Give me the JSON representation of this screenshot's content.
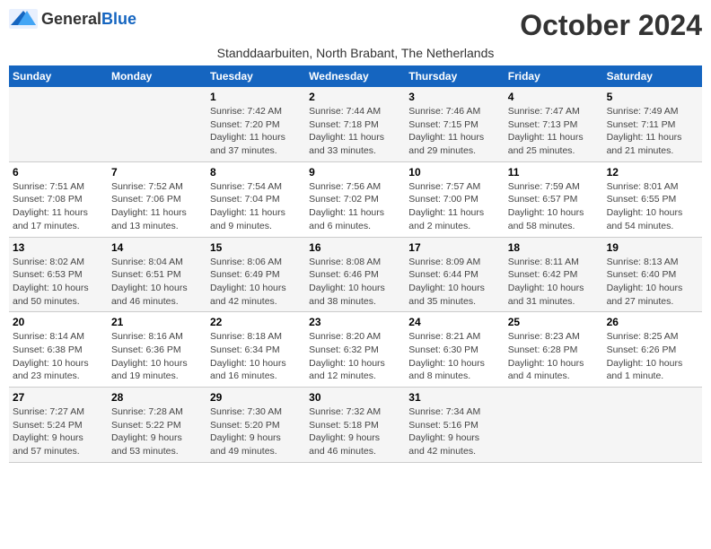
{
  "header": {
    "logo_general": "General",
    "logo_blue": "Blue",
    "month": "October 2024",
    "subtitle": "Standdaarbuiten, North Brabant, The Netherlands"
  },
  "weekdays": [
    "Sunday",
    "Monday",
    "Tuesday",
    "Wednesday",
    "Thursday",
    "Friday",
    "Saturday"
  ],
  "weeks": [
    [
      {
        "day": "",
        "info": ""
      },
      {
        "day": "",
        "info": ""
      },
      {
        "day": "1",
        "info": "Sunrise: 7:42 AM\nSunset: 7:20 PM\nDaylight: 11 hours\nand 37 minutes."
      },
      {
        "day": "2",
        "info": "Sunrise: 7:44 AM\nSunset: 7:18 PM\nDaylight: 11 hours\nand 33 minutes."
      },
      {
        "day": "3",
        "info": "Sunrise: 7:46 AM\nSunset: 7:15 PM\nDaylight: 11 hours\nand 29 minutes."
      },
      {
        "day": "4",
        "info": "Sunrise: 7:47 AM\nSunset: 7:13 PM\nDaylight: 11 hours\nand 25 minutes."
      },
      {
        "day": "5",
        "info": "Sunrise: 7:49 AM\nSunset: 7:11 PM\nDaylight: 11 hours\nand 21 minutes."
      }
    ],
    [
      {
        "day": "6",
        "info": "Sunrise: 7:51 AM\nSunset: 7:08 PM\nDaylight: 11 hours\nand 17 minutes."
      },
      {
        "day": "7",
        "info": "Sunrise: 7:52 AM\nSunset: 7:06 PM\nDaylight: 11 hours\nand 13 minutes."
      },
      {
        "day": "8",
        "info": "Sunrise: 7:54 AM\nSunset: 7:04 PM\nDaylight: 11 hours\nand 9 minutes."
      },
      {
        "day": "9",
        "info": "Sunrise: 7:56 AM\nSunset: 7:02 PM\nDaylight: 11 hours\nand 6 minutes."
      },
      {
        "day": "10",
        "info": "Sunrise: 7:57 AM\nSunset: 7:00 PM\nDaylight: 11 hours\nand 2 minutes."
      },
      {
        "day": "11",
        "info": "Sunrise: 7:59 AM\nSunset: 6:57 PM\nDaylight: 10 hours\nand 58 minutes."
      },
      {
        "day": "12",
        "info": "Sunrise: 8:01 AM\nSunset: 6:55 PM\nDaylight: 10 hours\nand 54 minutes."
      }
    ],
    [
      {
        "day": "13",
        "info": "Sunrise: 8:02 AM\nSunset: 6:53 PM\nDaylight: 10 hours\nand 50 minutes."
      },
      {
        "day": "14",
        "info": "Sunrise: 8:04 AM\nSunset: 6:51 PM\nDaylight: 10 hours\nand 46 minutes."
      },
      {
        "day": "15",
        "info": "Sunrise: 8:06 AM\nSunset: 6:49 PM\nDaylight: 10 hours\nand 42 minutes."
      },
      {
        "day": "16",
        "info": "Sunrise: 8:08 AM\nSunset: 6:46 PM\nDaylight: 10 hours\nand 38 minutes."
      },
      {
        "day": "17",
        "info": "Sunrise: 8:09 AM\nSunset: 6:44 PM\nDaylight: 10 hours\nand 35 minutes."
      },
      {
        "day": "18",
        "info": "Sunrise: 8:11 AM\nSunset: 6:42 PM\nDaylight: 10 hours\nand 31 minutes."
      },
      {
        "day": "19",
        "info": "Sunrise: 8:13 AM\nSunset: 6:40 PM\nDaylight: 10 hours\nand 27 minutes."
      }
    ],
    [
      {
        "day": "20",
        "info": "Sunrise: 8:14 AM\nSunset: 6:38 PM\nDaylight: 10 hours\nand 23 minutes."
      },
      {
        "day": "21",
        "info": "Sunrise: 8:16 AM\nSunset: 6:36 PM\nDaylight: 10 hours\nand 19 minutes."
      },
      {
        "day": "22",
        "info": "Sunrise: 8:18 AM\nSunset: 6:34 PM\nDaylight: 10 hours\nand 16 minutes."
      },
      {
        "day": "23",
        "info": "Sunrise: 8:20 AM\nSunset: 6:32 PM\nDaylight: 10 hours\nand 12 minutes."
      },
      {
        "day": "24",
        "info": "Sunrise: 8:21 AM\nSunset: 6:30 PM\nDaylight: 10 hours\nand 8 minutes."
      },
      {
        "day": "25",
        "info": "Sunrise: 8:23 AM\nSunset: 6:28 PM\nDaylight: 10 hours\nand 4 minutes."
      },
      {
        "day": "26",
        "info": "Sunrise: 8:25 AM\nSunset: 6:26 PM\nDaylight: 10 hours\nand 1 minute."
      }
    ],
    [
      {
        "day": "27",
        "info": "Sunrise: 7:27 AM\nSunset: 5:24 PM\nDaylight: 9 hours\nand 57 minutes."
      },
      {
        "day": "28",
        "info": "Sunrise: 7:28 AM\nSunset: 5:22 PM\nDaylight: 9 hours\nand 53 minutes."
      },
      {
        "day": "29",
        "info": "Sunrise: 7:30 AM\nSunset: 5:20 PM\nDaylight: 9 hours\nand 49 minutes."
      },
      {
        "day": "30",
        "info": "Sunrise: 7:32 AM\nSunset: 5:18 PM\nDaylight: 9 hours\nand 46 minutes."
      },
      {
        "day": "31",
        "info": "Sunrise: 7:34 AM\nSunset: 5:16 PM\nDaylight: 9 hours\nand 42 minutes."
      },
      {
        "day": "",
        "info": ""
      },
      {
        "day": "",
        "info": ""
      }
    ]
  ]
}
